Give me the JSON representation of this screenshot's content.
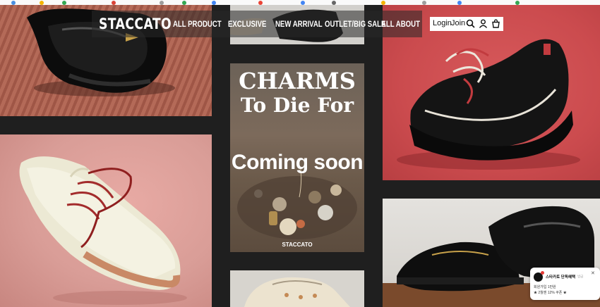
{
  "nav": {
    "logo": "STACCATO",
    "links": [
      "ALL PRODUCT",
      "EXCLUSIVE",
      "NEW ARRIVAL",
      "OUTLET/BIG SALE",
      "ALL ABOUT"
    ],
    "login": "Login",
    "join": "Join",
    "icons": [
      "search-icon",
      "user-icon",
      "cart-icon"
    ]
  },
  "promo": {
    "title_line1": "CHARMS",
    "title_line2": "To Die For",
    "coming_soon": "Coming soon",
    "brand_small": "STACCATO"
  },
  "chat": {
    "name": "스타카토 단독혜택",
    "time": "방금",
    "line1": "회원가입 1만원",
    "line2": "★ 2월엔 12% 쿠폰 ★"
  },
  "colors": {
    "page_bg": "#1f1f1f",
    "red_panel": "#cb4b4e",
    "pink_panel": "#e0a39d",
    "rust_panel": "#a95f4e"
  }
}
